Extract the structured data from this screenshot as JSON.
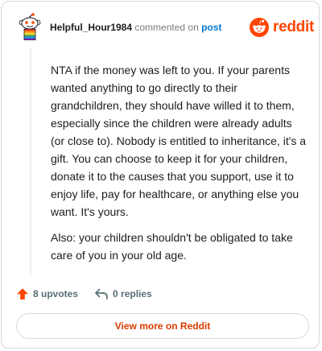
{
  "header": {
    "username": "Helpful_Hour1984",
    "action_text": " commented on ",
    "link_text": "post",
    "brand_name": "reddit"
  },
  "comment": {
    "paragraphs": [
      "NTA if the money was left to you. If your parents wanted anything to go directly to their grandchildren, they should have willed it to them, especially since the children were already adults (or close to). Nobody is entitled to inheritance, it's a gift. You can choose to keep it for your children, donate it to the causes that you support, use it to enjoy life, pay for healthcare, or anything else you want. It's yours.",
      "Also: your children shouldn't be obligated to take care of you in your old age."
    ]
  },
  "footer": {
    "upvotes_label": "8 upvotes",
    "replies_label": "0 replies"
  },
  "cta": {
    "label": "View more on Reddit"
  },
  "colors": {
    "brand": "#ff4500",
    "link": "#0079d3",
    "cta_text": "#d93a00",
    "upvote": "#ff4500"
  },
  "icons": {
    "brand_logo": "reddit-snoo-icon",
    "upvote": "upvote-arrow-icon",
    "reply": "reply-arrow-icon",
    "avatar": "snoo-avatar-icon"
  }
}
